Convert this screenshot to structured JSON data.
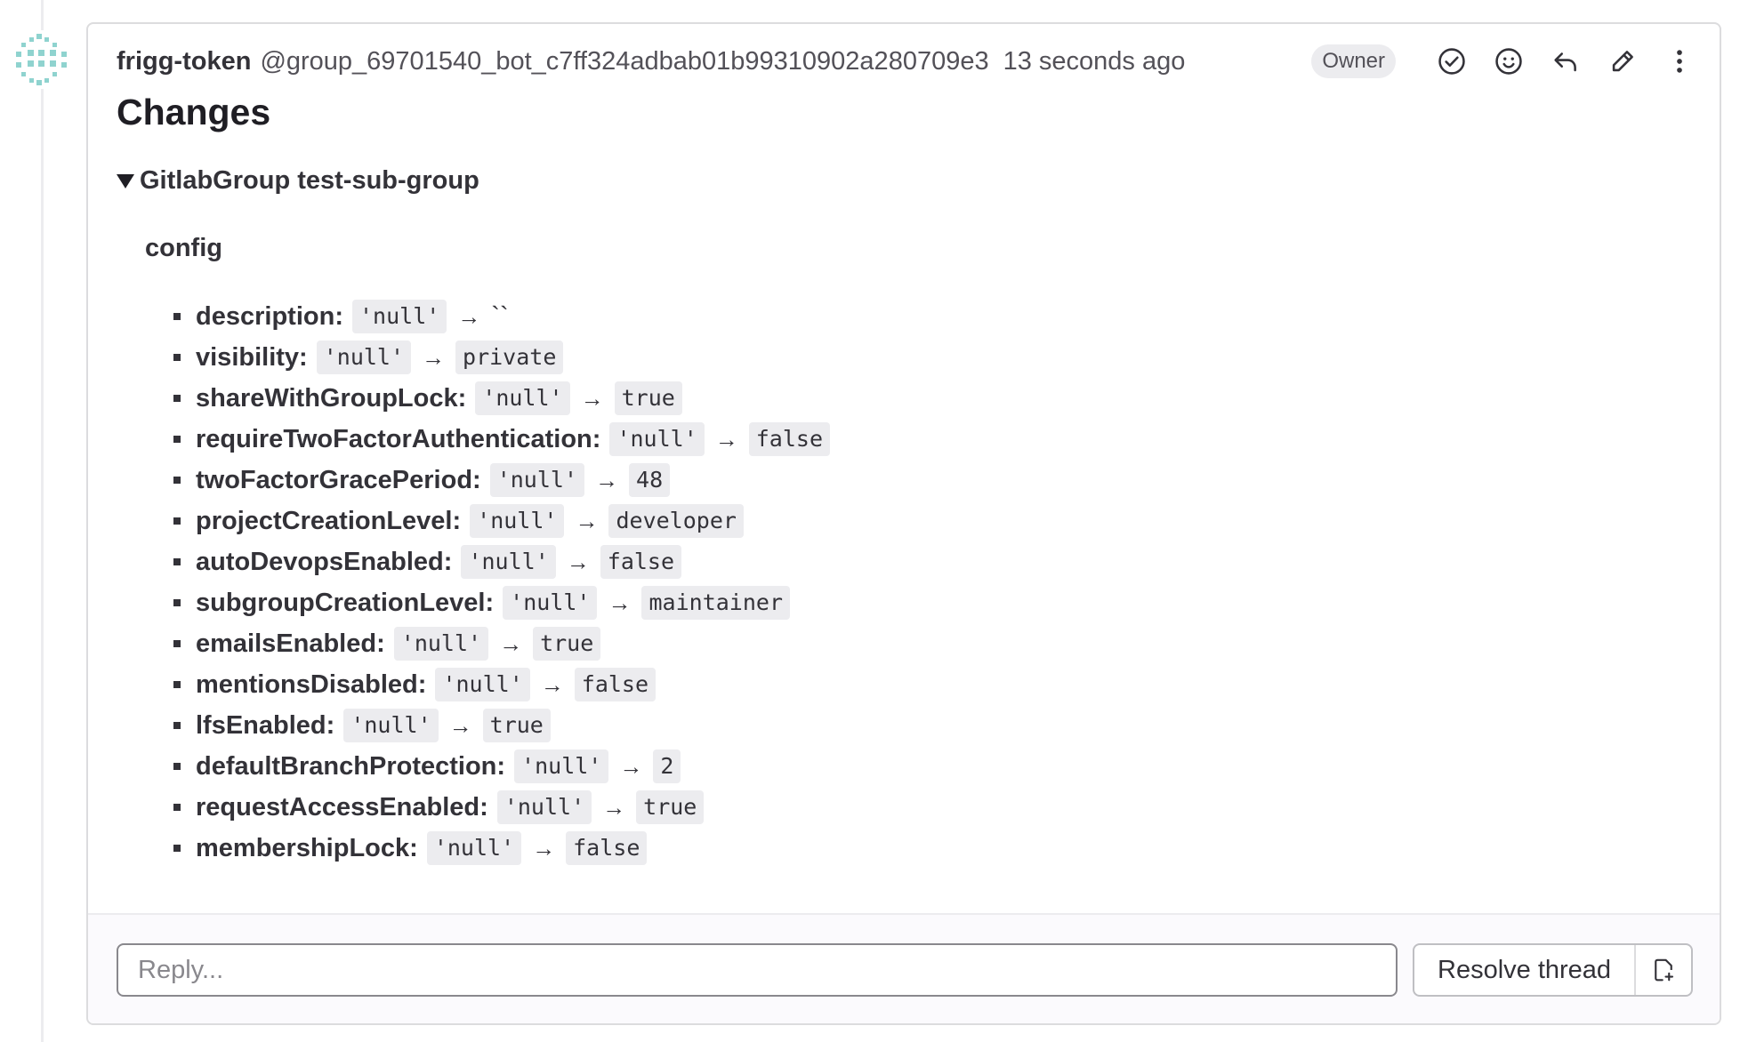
{
  "comment": {
    "author_name": "frigg-token",
    "author_handle": "@group_69701540_bot_c7ff324adbab01b99310902a280709e3",
    "time": "13 seconds ago",
    "role_badge": "Owner",
    "actions": [
      {
        "name": "resolve-check-icon"
      },
      {
        "name": "emoji-reaction-icon"
      },
      {
        "name": "reply-icon"
      },
      {
        "name": "edit-pencil-icon"
      },
      {
        "name": "more-actions-icon"
      }
    ]
  },
  "body": {
    "title": "Changes",
    "details_summary": "GitlabGroup test-sub-group",
    "section_label": "config",
    "changes": [
      {
        "key": "description",
        "old": "'null'",
        "new": "``"
      },
      {
        "key": "visibility",
        "old": "'null'",
        "new": "private"
      },
      {
        "key": "shareWithGroupLock",
        "old": "'null'",
        "new": "true"
      },
      {
        "key": "requireTwoFactorAuthentication",
        "old": "'null'",
        "new": "false"
      },
      {
        "key": "twoFactorGracePeriod",
        "old": "'null'",
        "new": "48"
      },
      {
        "key": "projectCreationLevel",
        "old": "'null'",
        "new": "developer"
      },
      {
        "key": "autoDevopsEnabled",
        "old": "'null'",
        "new": "false"
      },
      {
        "key": "subgroupCreationLevel",
        "old": "'null'",
        "new": "maintainer"
      },
      {
        "key": "emailsEnabled",
        "old": "'null'",
        "new": "true"
      },
      {
        "key": "mentionsDisabled",
        "old": "'null'",
        "new": "false"
      },
      {
        "key": "lfsEnabled",
        "old": "'null'",
        "new": "true"
      },
      {
        "key": "defaultBranchProtection",
        "old": "'null'",
        "new": "2"
      },
      {
        "key": "requestAccessEnabled",
        "old": "'null'",
        "new": "true"
      },
      {
        "key": "membershipLock",
        "old": "'null'",
        "new": "false"
      }
    ]
  },
  "footer": {
    "reply_placeholder": "Reply...",
    "resolve_label": "Resolve thread"
  }
}
